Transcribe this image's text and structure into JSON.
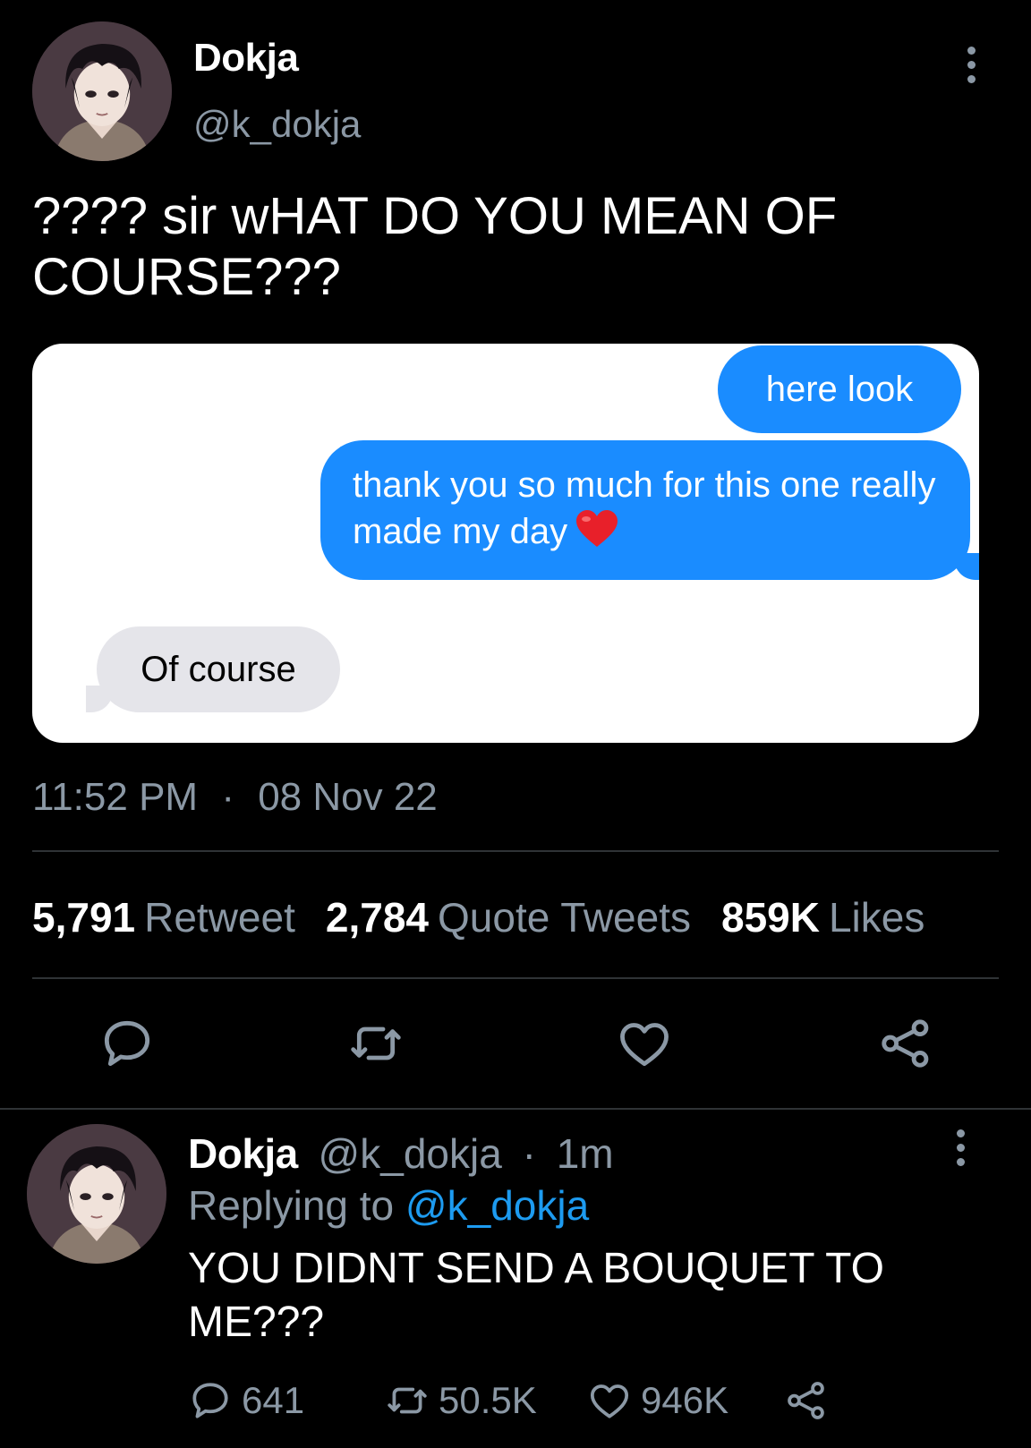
{
  "tweet": {
    "author_name": "Dokja",
    "author_handle": "@k_dokja",
    "text": "???? sir wHAT DO YOU MEAN OF COURSE???",
    "time": "11:52 PM",
    "date_separator": "·",
    "date": "08 Nov 22",
    "media": {
      "messages": [
        {
          "side": "sent",
          "text": "here look"
        },
        {
          "side": "sent",
          "text": "thank you so much for this one really made my day"
        },
        {
          "side": "received",
          "text": "Of course"
        }
      ],
      "heart_emoji": "red-heart-emoji"
    },
    "stats": {
      "retweets_count": "5,791",
      "retweets_label": "Retweet",
      "quotes_count": "2,784",
      "quotes_label": "Quote Tweets",
      "likes_count": "859K",
      "likes_label": "Likes"
    },
    "actions": [
      "reply-icon",
      "retweet-icon",
      "like-icon",
      "share-icon"
    ]
  },
  "reply": {
    "author_name": "Dokja",
    "author_handle": "@k_dokja",
    "separator": "·",
    "time": "1m",
    "replying_label": "Replying to",
    "replying_to": "@k_dokja",
    "text": "YOU DIDNT SEND A BOUQUET TO ME???",
    "counts": {
      "replies": "641",
      "retweets": "50.5K",
      "likes": "946K"
    }
  },
  "colors": {
    "background": "#000000",
    "muted": "#8b98a5",
    "link": "#1d9bf0",
    "imessage_blue": "#1a8cff",
    "imessage_gray": "#e5e5ea"
  }
}
